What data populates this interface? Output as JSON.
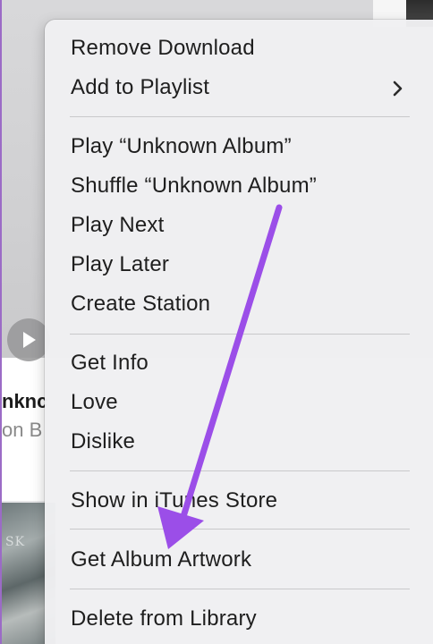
{
  "background": {
    "album_title": "nknc",
    "album_artist": "on B",
    "artwork_text": "SK",
    "play_icon": "play-icon"
  },
  "menu": {
    "items": [
      {
        "label": "Remove Download"
      },
      {
        "label": "Add to Playlist",
        "submenu": true
      },
      {
        "label": "Play “Unknown Album”"
      },
      {
        "label": "Shuffle “Unknown Album”"
      },
      {
        "label": "Play Next"
      },
      {
        "label": "Play Later"
      },
      {
        "label": "Create Station"
      },
      {
        "label": "Get Info"
      },
      {
        "label": "Love"
      },
      {
        "label": "Dislike"
      },
      {
        "label": "Show in iTunes Store"
      },
      {
        "label": "Get Album Artwork"
      },
      {
        "label": "Delete from Library"
      }
    ],
    "submenu_icon": "chevron-right-icon"
  },
  "annotation": {
    "arrow_color": "#9b4ee8",
    "points_to": "Get Album Artwork"
  }
}
